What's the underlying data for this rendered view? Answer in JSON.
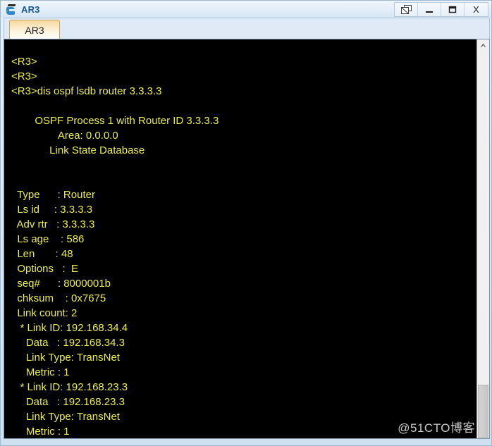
{
  "window": {
    "title": "AR3",
    "icon": "router-icon",
    "buttons": [
      {
        "name": "restore-window-button",
        "icon": "restore-icon",
        "label": ""
      },
      {
        "name": "minimize-window-button",
        "icon": "minimize-icon",
        "label": "_"
      },
      {
        "name": "maximize-window-button",
        "icon": "maximize-icon",
        "label": ""
      },
      {
        "name": "close-window-button",
        "icon": "close-icon",
        "label": "X"
      }
    ]
  },
  "tabs": [
    {
      "label": "AR3",
      "active": true
    }
  ],
  "terminal": {
    "background_color": "#000000",
    "text_color": "#eded4a",
    "lines": [
      "<R3>",
      "<R3>",
      "<R3>dis ospf lsdb router 3.3.3.3",
      "",
      "        OSPF Process 1 with Router ID 3.3.3.3",
      "                Area: 0.0.0.0",
      "             Link State Database",
      "",
      "",
      "  Type      : Router",
      "  Ls id     : 3.3.3.3",
      "  Adv rtr   : 3.3.3.3",
      "  Ls age    : 586",
      "  Len       : 48",
      "  Options   :  E",
      "  seq#      : 8000001b",
      "  chksum    : 0x7675",
      "  Link count: 2",
      "   * Link ID: 192.168.34.4",
      "     Data   : 192.168.34.3",
      "     Link Type: TransNet",
      "     Metric : 1",
      "   * Link ID: 192.168.23.3",
      "     Data   : 192.168.23.3",
      "     Link Type: TransNet",
      "     Metric : 1"
    ],
    "command": "dis ospf lsdb router 3.3.3.3",
    "prompt": "<R3>",
    "header": {
      "process": "OSPF Process 1 with Router ID 3.3.3.3",
      "area": "Area: 0.0.0.0",
      "database": "Link State Database"
    },
    "lsa": {
      "Type": "Router",
      "Ls id": "3.3.3.3",
      "Adv rtr": "3.3.3.3",
      "Ls age": "586",
      "Len": "48",
      "Options": "E",
      "seq#": "8000001b",
      "chksum": "0x7675",
      "Link count": "2"
    },
    "links": [
      {
        "link_id": "192.168.34.4",
        "data": "192.168.34.3",
        "link_type": "TransNet",
        "metric": "1"
      },
      {
        "link_id": "192.168.23.3",
        "data": "192.168.23.3",
        "link_type": "TransNet",
        "metric": "1"
      }
    ]
  },
  "scrollbar": {
    "up_arrow": "chevron-up-icon",
    "thumb_position": "bottom"
  },
  "watermark": "@51CTO博客"
}
